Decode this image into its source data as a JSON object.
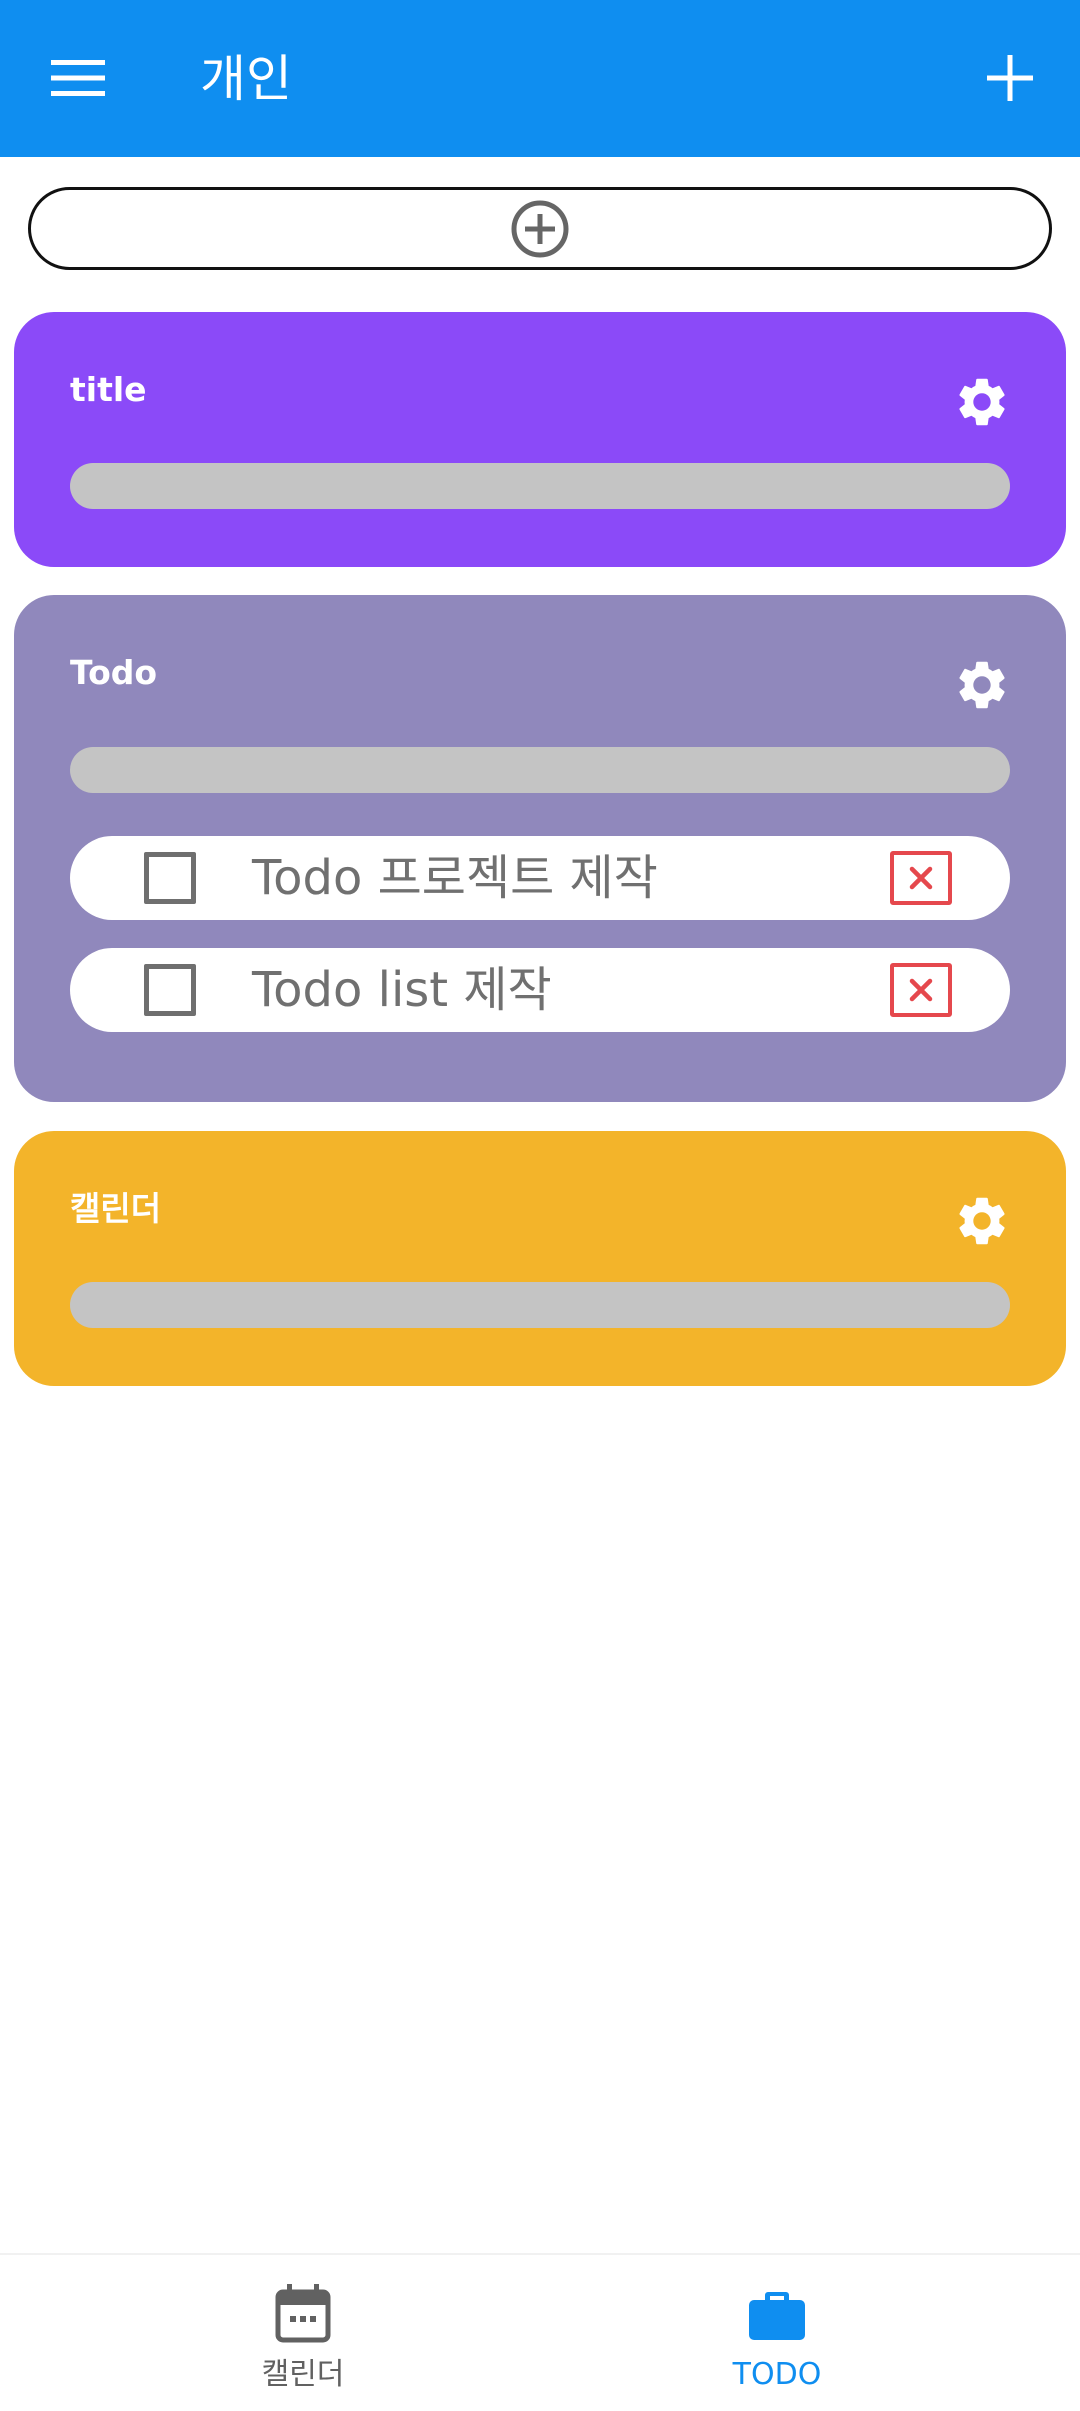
{
  "appbar": {
    "title": "개인",
    "menu_icon": "hamburger-menu-icon",
    "add_icon": "plus-icon",
    "background": "#0f8ef0"
  },
  "add_group": {
    "icon": "add-circle-icon"
  },
  "cards": [
    {
      "title": "title",
      "color": "#8b4af8",
      "progress": 0,
      "items": []
    },
    {
      "title": "Todo",
      "color": "#9088bc",
      "progress": 0,
      "items": [
        {
          "text": "Todo 프로젝트 제작",
          "checked": false
        },
        {
          "text": "Todo list 제작",
          "checked": false
        }
      ]
    },
    {
      "title": "캘린더",
      "color": "#f3b42a",
      "progress": 0,
      "items": []
    }
  ],
  "bottom_nav": {
    "items": [
      {
        "label": "캘린더",
        "icon": "calendar-icon",
        "active": false
      },
      {
        "label": "TODO",
        "icon": "briefcase-icon",
        "active": true
      }
    ],
    "active_color": "#0f8ef0",
    "inactive_color": "#616161"
  },
  "colors": {
    "delete": "#e5484d",
    "progress_track": "#c4c4c4"
  }
}
